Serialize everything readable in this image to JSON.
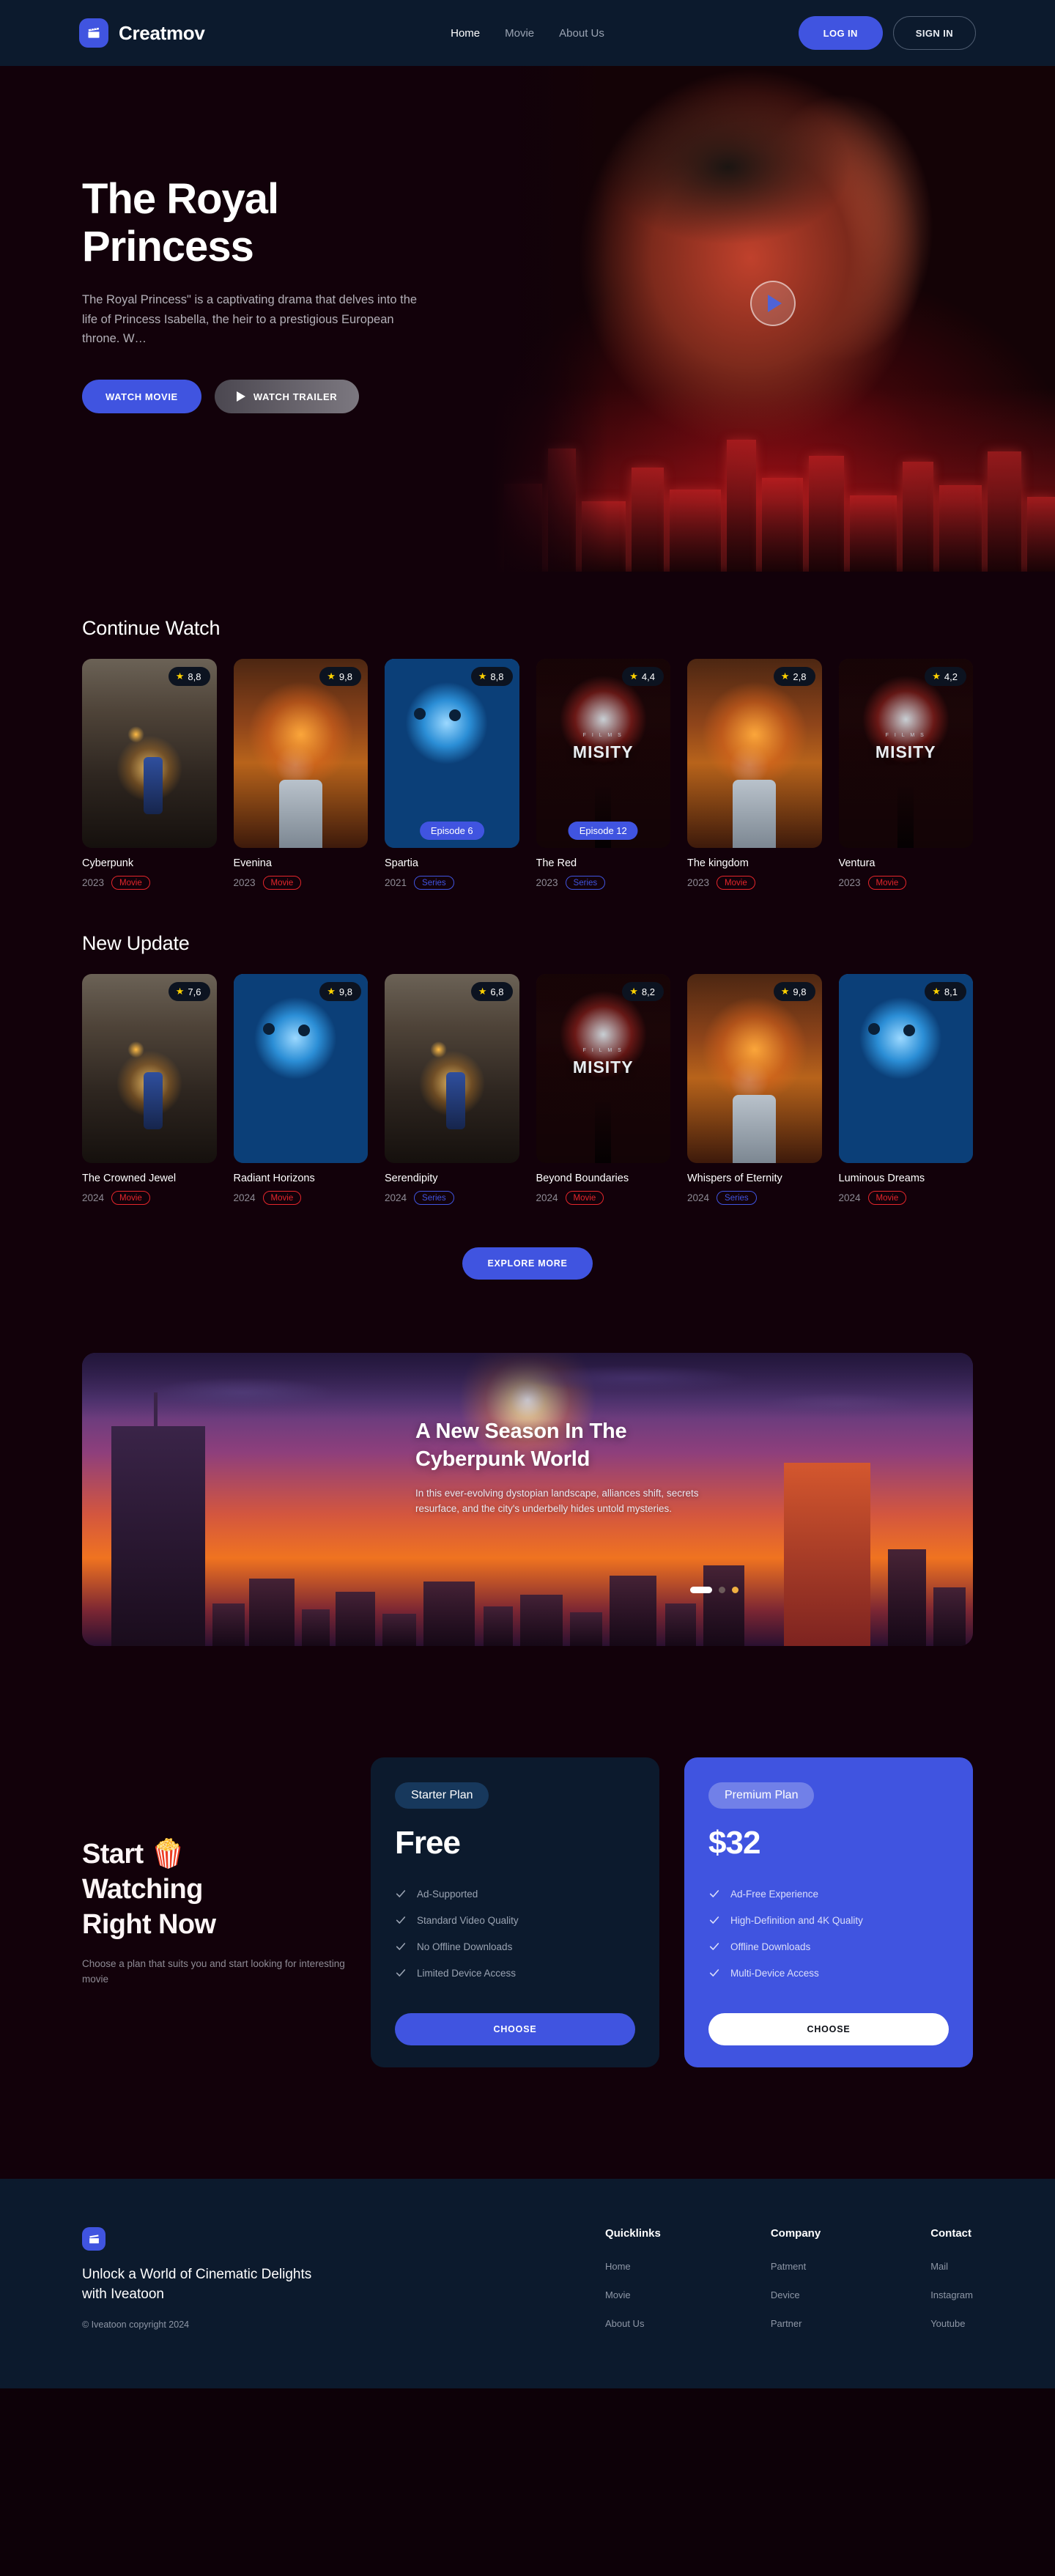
{
  "brand": {
    "name": "Creatmov",
    "logo_icon": "clapperboard-icon"
  },
  "nav": {
    "links": [
      {
        "label": "Home",
        "active": true
      },
      {
        "label": "Movie",
        "active": false
      },
      {
        "label": "About Us",
        "active": false
      }
    ],
    "login_label": "LOG IN",
    "signin_label": "SIGN IN"
  },
  "hero": {
    "title": "The Royal Princess",
    "description": "The Royal Princess\" is a captivating drama that delves into the life of Princess Isabella, the heir to a prestigious European throne. W…",
    "watch_movie_label": "WATCH MOVIE",
    "watch_trailer_label": "WATCH TRAILER",
    "play_icon": "play-icon"
  },
  "continue_watch": {
    "title": "Continue Watch",
    "cards": [
      {
        "title": "Cyberpunk",
        "year": "2023",
        "type": "Movie",
        "rating": "8,8",
        "episode": null,
        "art": "art-fire"
      },
      {
        "title": "Evenina",
        "year": "2023",
        "type": "Movie",
        "rating": "9,8",
        "episode": null,
        "art": "art-pop"
      },
      {
        "title": "Spartia",
        "year": "2021",
        "type": "Series",
        "rating": "8,8",
        "episode": "Episode 6",
        "art": "art-blue"
      },
      {
        "title": "The Red",
        "year": "2023",
        "type": "Series",
        "rating": "4,4",
        "episode": "Episode 12",
        "art": "art-misity"
      },
      {
        "title": "The kingdom",
        "year": "2023",
        "type": "Movie",
        "rating": "2,8",
        "episode": null,
        "art": "art-pop"
      },
      {
        "title": "Ventura",
        "year": "2023",
        "type": "Movie",
        "rating": "4,2",
        "episode": null,
        "art": "art-misity"
      }
    ]
  },
  "new_update": {
    "title": "New Update",
    "cards": [
      {
        "title": "The Crowned Jewel",
        "year": "2024",
        "type": "Movie",
        "rating": "7,6",
        "episode": null,
        "art": "art-fire"
      },
      {
        "title": "Radiant Horizons",
        "year": "2024",
        "type": "Movie",
        "rating": "9,8",
        "episode": null,
        "art": "art-blue"
      },
      {
        "title": "Serendipity",
        "year": "2024",
        "type": "Series",
        "rating": "6,8",
        "episode": null,
        "art": "art-fire"
      },
      {
        "title": "Beyond Boundaries",
        "year": "2024",
        "type": "Movie",
        "rating": "8,2",
        "episode": null,
        "art": "art-misity"
      },
      {
        "title": "Whispers of Eternity",
        "year": "2024",
        "type": "Series",
        "rating": "9,8",
        "episode": null,
        "art": "art-pop"
      },
      {
        "title": "Luminous Dreams",
        "year": "2024",
        "type": "Movie",
        "rating": "8,1",
        "episode": null,
        "art": "art-blue"
      }
    ],
    "explore_label": "EXPLORE MORE"
  },
  "banner": {
    "title_line1": "A New Season In The",
    "title_line2": "Cyberpunk World",
    "description": "In this ever-evolving dystopian landscape, alliances shift, secrets resurface, and the city's underbelly hides untold mysteries.",
    "dots": [
      {
        "state": "active"
      },
      {
        "state": "inactive"
      },
      {
        "state": "amber"
      }
    ]
  },
  "pricing": {
    "heading_line1": "Start 🍿",
    "heading_line2": "Watching",
    "heading_line3": "Right Now",
    "subtitle": "Choose a plan that suits you and start looking for interesting movie",
    "plans": [
      {
        "tag": "Starter Plan",
        "price": "Free",
        "features": [
          "Ad-Supported",
          "Standard Video Quality",
          "No Offline Downloads",
          "Limited Device Access"
        ],
        "button_label": "CHOOSE",
        "variant": "starter"
      },
      {
        "tag": "Premium Plan",
        "price": "$32",
        "features": [
          "Ad-Free Experience",
          "High-Definition and 4K Quality",
          "Offline Downloads",
          "Multi-Device Access"
        ],
        "button_label": "CHOOSE",
        "variant": "premium"
      }
    ]
  },
  "footer": {
    "logo_icon": "clapperboard-icon",
    "tagline": "Unlock a World of Cinematic Delights with Iveatoon",
    "copyright": "© Iveatoon copyright 2024",
    "columns": [
      {
        "title": "Quicklinks",
        "links": [
          "Home",
          "Movie",
          "About Us"
        ]
      },
      {
        "title": "Company",
        "links": [
          "Patment",
          "Device",
          "Partner"
        ]
      },
      {
        "title": "Contact",
        "links": [
          "Mail",
          "Instagram",
          "Youtube"
        ]
      }
    ]
  },
  "colors": {
    "accent": "#4054e0",
    "navy": "#0c1a2d",
    "page_bg": "#12010a",
    "movie_pill": "#e4262b",
    "series_pill": "#4054e0",
    "star": "#ffd200"
  }
}
